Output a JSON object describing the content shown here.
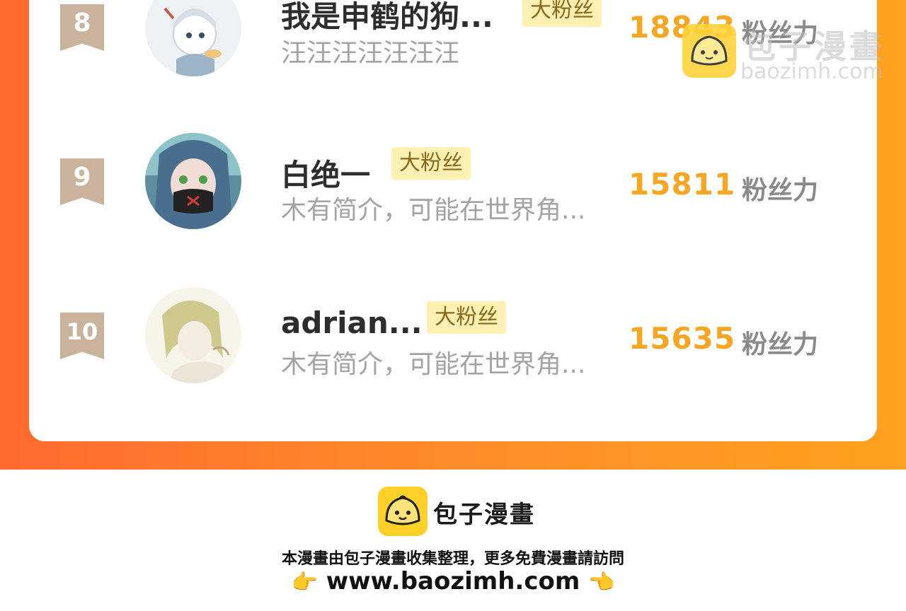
{
  "leaderboard": {
    "rows": [
      {
        "rank": "8",
        "name": "我是申鹤的狗...",
        "badge": "大粉丝",
        "bio": "汪汪汪汪汪汪汪",
        "score": "18843",
        "unit": "粉丝力"
      },
      {
        "rank": "9",
        "name": "白绝一",
        "badge": "大粉丝",
        "bio": "木有简介，可能在世界角...",
        "score": "15811",
        "unit": "粉丝力"
      },
      {
        "rank": "10",
        "name": "adrian...",
        "badge": "大粉丝",
        "bio": "木有简介，可能在世界角...",
        "score": "15635",
        "unit": "粉丝力"
      }
    ]
  },
  "watermark": {
    "brand": "包子漫畫",
    "url": "baozimh.com"
  },
  "footer": {
    "brand": "包子漫畫",
    "note": "本漫畫由包子漫畫收集整理，更多免費漫畫請訪問",
    "url": "www.baozimh.com",
    "left_icon": "pointing-right-hand",
    "right_icon": "pointing-left-hand"
  },
  "colors": {
    "gradient_start": "#ff6a2e",
    "gradient_end": "#ffa21f",
    "score": "#f5a623",
    "badge_bg": "#fff0b3",
    "rank_bg": "#c9b39c"
  }
}
